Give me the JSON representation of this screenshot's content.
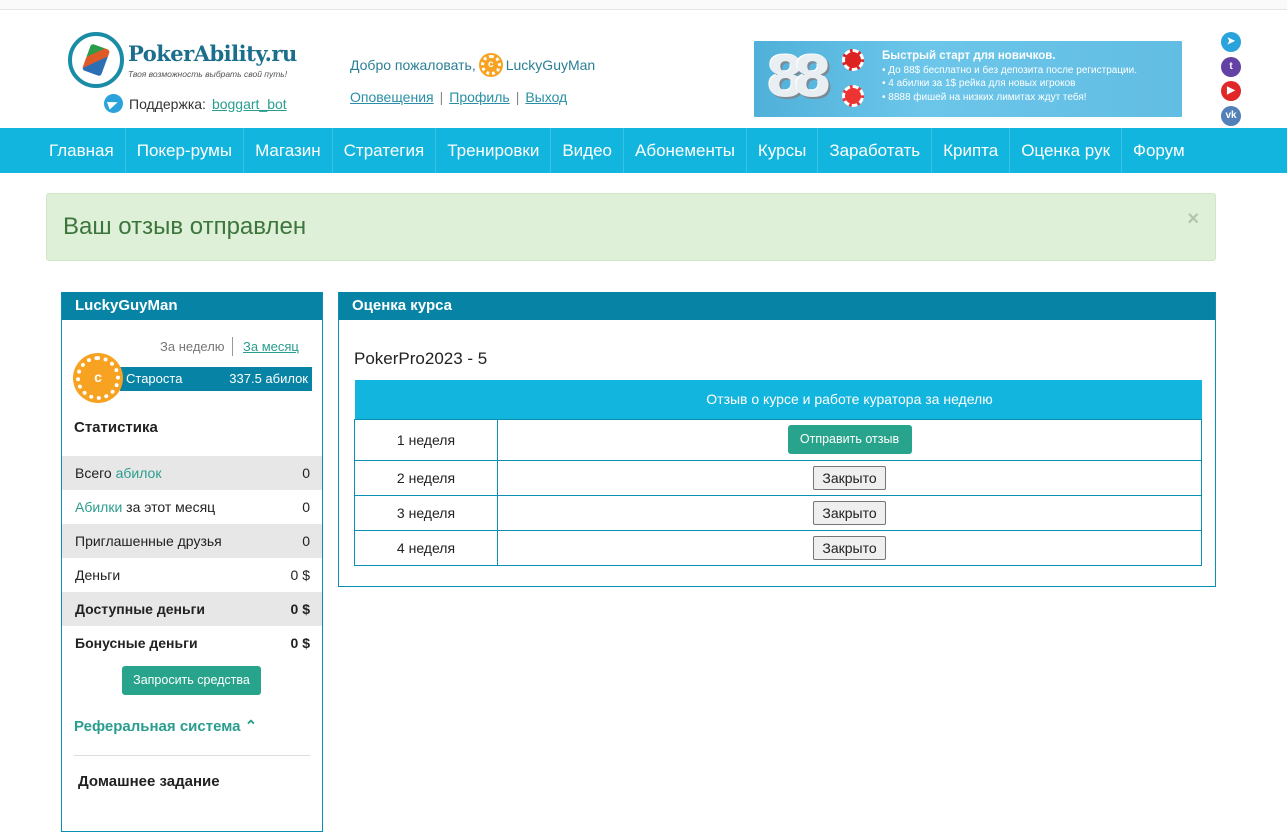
{
  "header": {
    "logo_name": "PokerAbility.ru",
    "logo_tagline": "Твоя возможность выбрать свой путь!",
    "support_label": "Поддержка:",
    "support_link": "boggart_bot",
    "welcome_text": "Добро пожаловать,",
    "username": "LuckyGuyMan",
    "user_links": [
      "Оповещения",
      "Профиль",
      "Выход"
    ],
    "banner": {
      "title": "Быстрый старт для новичков.",
      "line1": "До 88$ бесплатно и без депозита после регистрации.",
      "line2": "4 абилки за 1$ рейка для новых игроков",
      "line3": "8888 фишей на низких лимитах ждут тебя!"
    },
    "social_icons": [
      "telegram-icon",
      "twitch-icon",
      "youtube-icon",
      "vk-icon"
    ]
  },
  "nav": [
    "Главная",
    "Покер-румы",
    "Магазин",
    "Стратегия",
    "Тренировки",
    "Видео",
    "Абонементы",
    "Курсы",
    "Заработать",
    "Крипта",
    "Оценка рук",
    "Форум"
  ],
  "alert": {
    "message": "Ваш отзыв отправлен",
    "close": "×"
  },
  "sidebar": {
    "title": "LuckyGuyMan",
    "period_week": "За неделю",
    "period_month": "За месяц",
    "rank_name": "Староста",
    "rank_value": "337.5 абилок",
    "stats_title": "Статистика",
    "stats": [
      {
        "label_pre": "Всего ",
        "label_hl": "абилок",
        "label_post": "",
        "value": "0"
      },
      {
        "label_pre": "",
        "label_hl": "Абилки",
        "label_post": " за этот месяц",
        "value": "0"
      },
      {
        "label_pre": "Приглашенные друзья",
        "label_hl": "",
        "label_post": "",
        "value": "0"
      },
      {
        "label_pre": "Деньги",
        "label_hl": "",
        "label_post": "",
        "value": "0 $"
      },
      {
        "label_pre": "Доступные деньги",
        "label_hl": "",
        "label_post": "",
        "value": "0 $"
      },
      {
        "label_pre": "Бонусные деньги",
        "label_hl": "",
        "label_post": "",
        "value": "0 $"
      }
    ],
    "request_button": "Запросить средства",
    "referral_label": "Реферальная система",
    "homework_title": "Домашнее задание"
  },
  "main": {
    "panel_title": "Оценка курса",
    "course_title": "PokerPro2023 - 5",
    "table_header": [
      "",
      "Отзыв о курсе и работе куратора за неделю"
    ],
    "rows": [
      {
        "week": "1 неделя",
        "action": "Отправить отзыв"
      },
      {
        "week": "2 неделя",
        "action": "Закрыто"
      },
      {
        "week": "3 неделя",
        "action": "Закрыто"
      },
      {
        "week": "4 неделя",
        "action": "Закрыто"
      }
    ]
  },
  "colors": {
    "nav_bg": "#12b5dd",
    "panel_head": "#0784a5",
    "accent_green": "#27a48b",
    "alert_bg": "#dff0d8"
  }
}
